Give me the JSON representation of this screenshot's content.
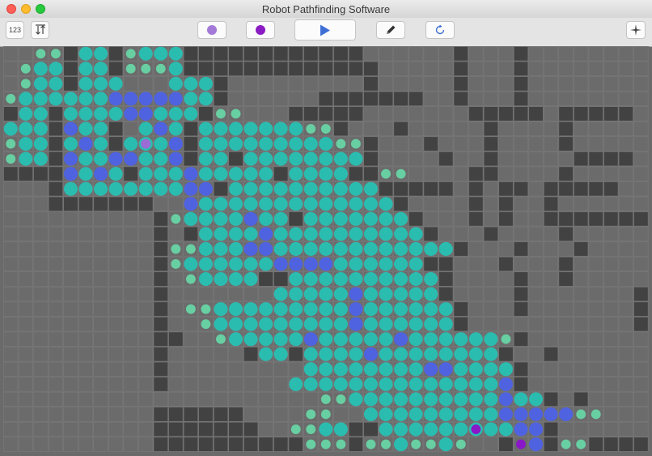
{
  "window": {
    "title": "Robot Pathfinding Software"
  },
  "toolbar": {
    "number_button_label": "123",
    "sort_icon": "sort-arrows-icon",
    "start_color": "#a37ad8",
    "goal_color": "#8b1cc4",
    "play_icon": "play-triangle-icon",
    "pencil_icon": "pencil-icon",
    "reset_icon": "refresh-icon",
    "crosshair_icon": "crosshair-icon"
  },
  "grid": {
    "cols": 43,
    "rows": 27,
    "colors": {
      "empty": "#6b6b6b",
      "wall": "#424242",
      "gridline": "#7a7a7a",
      "visited": "#2bbcb0",
      "frontier": "#68cfa3",
      "path": "#4f63e0",
      "start": "#9b6bd6",
      "goal": "#8a17c8"
    },
    "cells": [
      "..FF#VV#FVVV############......#...#.......",
      ".FVV#VV#FFFV#############.....#...#.......",
      ".FVV#VVV...VVV#.........#.....#...#.......",
      "FVVVVVVPPPPPVV#......#######..#...#.......",
      "#VV#VVVVPPVVV#FF...#####.......#####.#####",
      "VVV#PVV#.VPV#VVVVVVVFF#...#.....#....#....",
      "FVV#VPV#VVVP#VVVVVVVVVFF#...#...#....#....",
      "FVV#PVVPPVVP#VV#VVVVVVVV#....#..#.....####",
      "####PVPV#VVVPVVVVV#VVVV##FF....##....#....",
      "...#VVVVVVVVPP#VVVVVVVVVV#####.#.##.#####.",
      "...#######..PVVVVVVVVVVVVV#....#.#..#.....",
      "..........#FVVVVPVV#VVVVVVV#...#.#..#######",
      "..........#.#VVVVPVVVVVVVVVV#...#....#.....",
      "..........#FFVVVPPVVVVVVVVVVVV#...#...#....",
      "..........#FVVVVVVPPPPVVVVVV##...#...#.....",
      "..........#.FVVVV##VVVVVVVVVV#....#..#.....",
      "..........#.......VVVVVPVVVVV#....#.......#",
      "..........#.FFVVVVVVVVVPVVVVVV#...#.......#",
      "..........#..FVVVVVVVVVPVVVVVV#...........#",
      "..........##..FVVVVVPVVVVVPVVVVVVF#...........",
      "..........#.....#VV#VVVVPVVVVVVVV#..#.......",
      "..........#.........VVVVVVVVPPVVVV#........",
      "..........#........VVVVVVVVVVVVVVP#.......",
      ".....................FFVVVVVVVVVVPVV#.#.....",
      "..........######....FF..VVVVVVVVVPPPPPFF....",
      "..........#######..FFVV##VVVVVVVVVPP#.......",
      "..........##########FFF#FFVFFVF..#GP#FF#####"
    ],
    "start_marker": {
      "col": 9,
      "row": 6
    },
    "goal_marker": {
      "col": 31,
      "row": 25
    }
  }
}
